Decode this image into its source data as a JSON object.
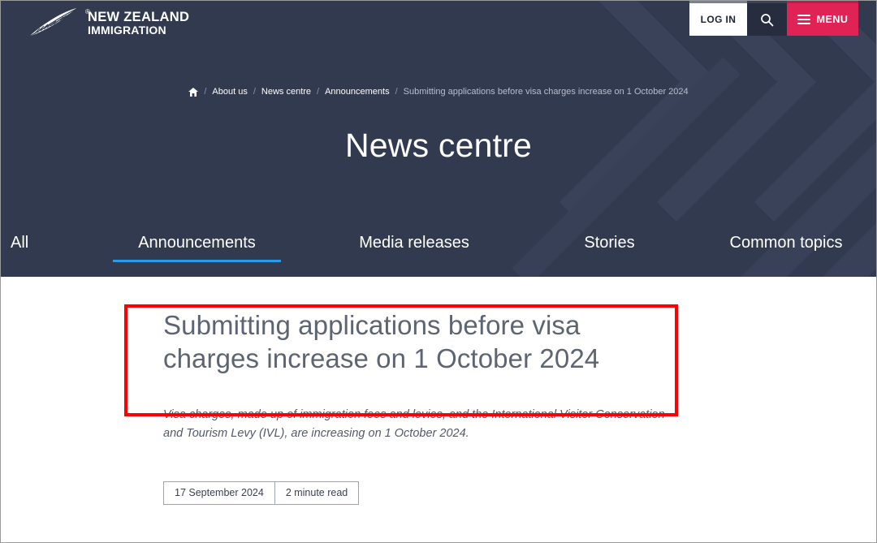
{
  "brand": {
    "line1": "NEW ZEALAND",
    "line2": "IMMIGRATION",
    "registered_mark": "®",
    "fern_icon": "silver-fern-icon"
  },
  "topbar": {
    "login_label": "LOG IN",
    "search_icon": "search-icon",
    "menu_label": "MENU",
    "menu_icon": "hamburger-icon",
    "menu_color": "#e02254",
    "login_bg": "#ffffff"
  },
  "breadcrumb": {
    "home_icon": "home-icon",
    "separator": "/",
    "items": [
      {
        "label": "About us",
        "current": false
      },
      {
        "label": "News centre",
        "current": false
      },
      {
        "label": "Announcements",
        "current": false
      },
      {
        "label": "Submitting applications before visa charges increase on 1 October 2024",
        "current": true
      }
    ]
  },
  "hero": {
    "title": "News centre",
    "background_color": "#323a50"
  },
  "tabs": {
    "active_index": 1,
    "active_underline_color": "#2b9ae8",
    "items": [
      {
        "label": "All"
      },
      {
        "label": "Announcements"
      },
      {
        "label": "Media releases"
      },
      {
        "label": "Stories"
      },
      {
        "label": "Common topics"
      }
    ]
  },
  "article": {
    "headline": "Submitting applications before visa charges increase on 1 October 2024",
    "summary": "Visa charges, made up of immigration fees and levies, and the International Visitor Conservation and Tourism Levy (IVL), are increasing on 1 October 2024.",
    "date": "17 September 2024",
    "read_time": "2 minute read"
  },
  "annotation": {
    "highlight_color": "#ff0000",
    "target": "article-headline"
  }
}
